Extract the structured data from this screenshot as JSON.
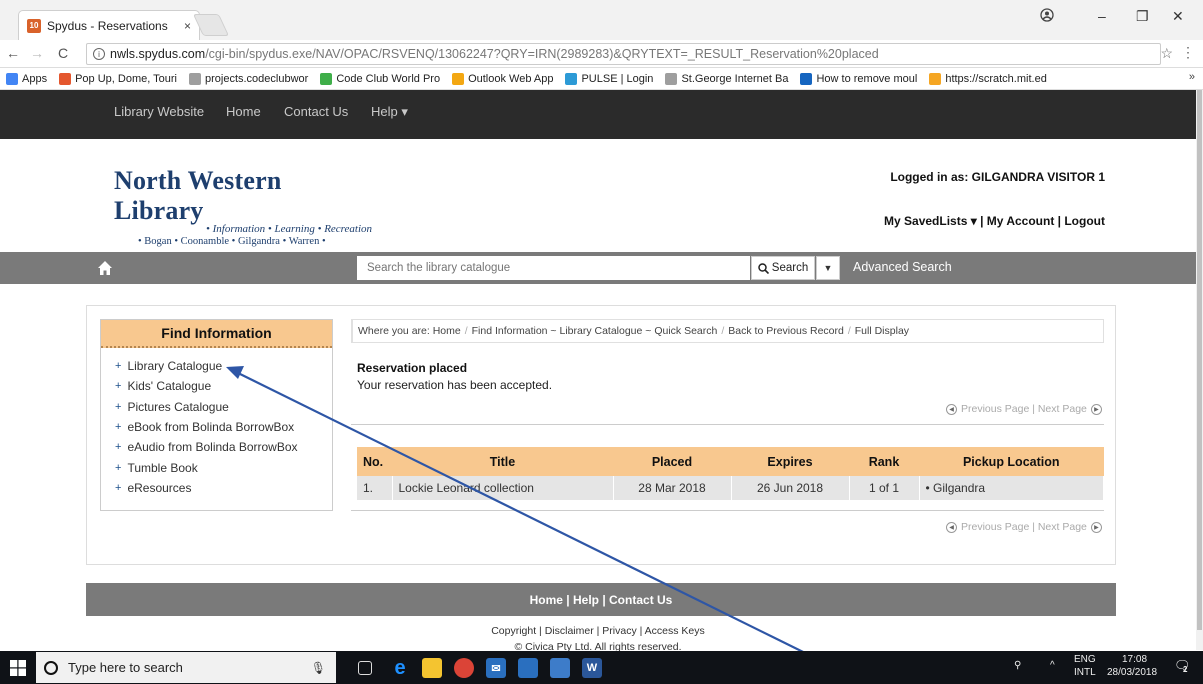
{
  "browser": {
    "tab_title": "Spydus - Reservations",
    "tab_close": "×",
    "favicon_text": "10",
    "url_host": "nwls.spydus.com",
    "url_path": "/cgi-bin/spydus.exe/NAV/OPAC/RSVENQ/13062247?QRY=IRN(2989283)&QRYTEXT=_RESULT_Reservation%20placed",
    "bookmarks": [
      {
        "label": "Apps",
        "color": "#4285f4"
      },
      {
        "label": "Pop Up, Dome, Touri",
        "color": "#e4572e"
      },
      {
        "label": "projects.codeclubwor",
        "color": "#9e9e9e"
      },
      {
        "label": "Code Club World Pro",
        "color": "#3fae49"
      },
      {
        "label": "Outlook Web App",
        "color": "#f3a712"
      },
      {
        "label": "PULSE | Login",
        "color": "#2c9ad6"
      },
      {
        "label": "St.George Internet Ba",
        "color": "#9e9e9e"
      },
      {
        "label": "How to remove moul",
        "color": "#1565c0"
      },
      {
        "label": "https://scratch.mit.ed",
        "color": "#f5a623"
      }
    ],
    "bookmarks_more": "»"
  },
  "site_nav": [
    "Library Website",
    "Home",
    "Contact Us",
    "Help ▾"
  ],
  "logo": {
    "main": "North Western Library",
    "sub1": "• Information • Learning • Recreation",
    "sub2": "• Bogan • Coonamble • Gilgandra • Warren •"
  },
  "user": {
    "logged_in": "Logged in as: GILGANDRA VISITOR 1",
    "account_links": "My SavedLists ▾ | My Account | Logout"
  },
  "search": {
    "placeholder": "Search the library catalogue",
    "button": "Search",
    "advanced": "Advanced Search"
  },
  "find_info": {
    "heading": "Find Information",
    "items": [
      "Library Catalogue",
      "Kids' Catalogue",
      "Pictures Catalogue",
      "eBook from Bolinda BorrowBox",
      "eAudio from Bolinda BorrowBox",
      "Tumble Book",
      "eResources"
    ]
  },
  "breadcrumb": {
    "prefix": "Where you are: Home",
    "parts": [
      "Find Information ~ Library Catalogue ~ Quick Search",
      "Back to Previous Record",
      "Full Display"
    ]
  },
  "reservation": {
    "title": "Reservation placed",
    "message": "Your reservation has been accepted."
  },
  "pager": "Previous Page | Next Page",
  "table": {
    "headers": [
      "No.",
      "Title",
      "Placed",
      "Expires",
      "Rank",
      "Pickup Location"
    ],
    "rows": [
      [
        "1.",
        "Lockie Leonard collection",
        "28 Mar 2018",
        "26 Jun 2018",
        "1 of 1",
        "• Gilgandra"
      ]
    ]
  },
  "footer": {
    "bar": "Home | Help | Contact Us",
    "links": "Copyright | Disclaimer | Privacy | Access Keys",
    "copy": "© Civica Pty Ltd. All rights reserved."
  },
  "taskbar": {
    "search_placeholder": "Type here to search",
    "lang1": "ENG",
    "lang2": "INTL",
    "time": "17:08",
    "date": "28/03/2018",
    "notif_count": "2"
  },
  "colors": {
    "accent_orange": "#f8c88f",
    "nav_dark": "#2b2b2b",
    "bar_grey": "#7a7a7a",
    "arrow_blue": "#2e56a6"
  }
}
